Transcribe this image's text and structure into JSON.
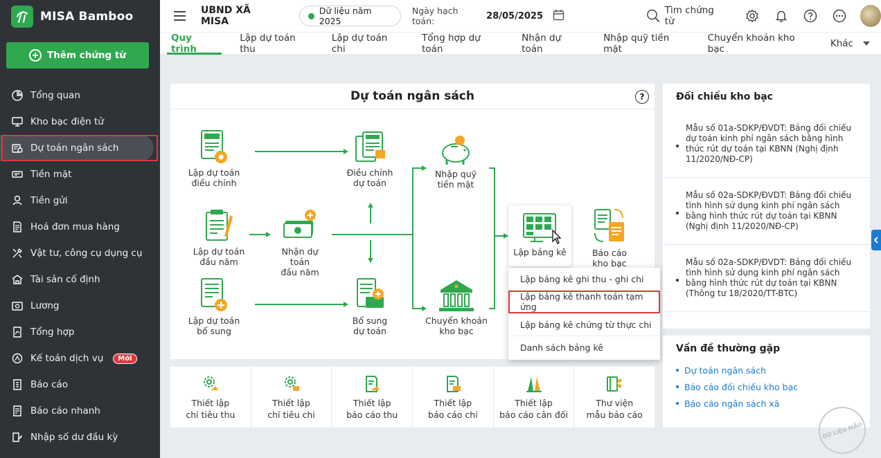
{
  "brand": {
    "name": "MISA Bamboo"
  },
  "sidebar": {
    "add_button": "Thêm chứng từ",
    "items": [
      {
        "label": "Tổng quan",
        "icon": "chart-icon"
      },
      {
        "label": "Kho bạc điện tử",
        "icon": "monitor-icon"
      },
      {
        "label": "Dự toán ngân sách",
        "icon": "budget-icon",
        "active": true
      },
      {
        "label": "Tiền mặt",
        "icon": "cash-icon"
      },
      {
        "label": "Tiền gửi",
        "icon": "deposit-icon"
      },
      {
        "label": "Hoá đơn mua hàng",
        "icon": "invoice-icon"
      },
      {
        "label": "Vật tư, công cụ dụng cụ",
        "icon": "tools-icon"
      },
      {
        "label": "Tài sản cố định",
        "icon": "asset-icon"
      },
      {
        "label": "Lương",
        "icon": "salary-icon"
      },
      {
        "label": "Tổng hợp",
        "icon": "summary-icon"
      },
      {
        "label": "Kế toán dịch vụ",
        "icon": "service-icon",
        "badge": "Mới"
      },
      {
        "label": "Báo cáo",
        "icon": "report-icon"
      },
      {
        "label": "Báo cáo nhanh",
        "icon": "quick-report-icon"
      },
      {
        "label": "Nhập số dư đầu kỳ",
        "icon": "opening-balance-icon"
      }
    ]
  },
  "topbar": {
    "org": "UBND XÃ MISA",
    "year": "Dữ liệu năm 2025",
    "accounting_label": "Ngày hạch toán:",
    "accounting_date": "28/05/2025",
    "search_label": "Tìm chứng từ"
  },
  "tabs": [
    {
      "label": "Quy trình",
      "active": true
    },
    {
      "label": "Lập dự toán thu"
    },
    {
      "label": "Lập dự toán chi"
    },
    {
      "label": "Tổng hợp dự toán"
    },
    {
      "label": "Nhận dự toán"
    },
    {
      "label": "Nhập quỹ tiền mặt"
    },
    {
      "label": "Chuyển khoản kho bạc"
    },
    {
      "label": "Khác"
    }
  ],
  "main": {
    "title": "Dự toán ngân sách",
    "help": "?",
    "nodes": {
      "lap_du_toan_dieu_chinh": "Lập dự toán\nđiều chỉnh",
      "dieu_chinh_du_toan": "Điều chỉnh\ndự toán",
      "nhap_quy_tien_mat": "Nhập quỹ\ntiền mặt",
      "lap_du_toan_dau_nam": "Lập dự toán\nđầu năm",
      "nhan_du_toan_dau_nam": "Nhận dự toán\nđầu năm",
      "lap_bang_ke": "Lập bảng kê",
      "bao_cao_kho_bac": "Báo cáo\nkho bạc",
      "lap_du_toan_bo_sung": "Lập dự toán\nbổ sung",
      "bo_sung_du_toan": "Bổ sung\ndự toán",
      "chuyen_khoan_kho_bac": "Chuyển khoản\nkho bạc"
    }
  },
  "dropdown": {
    "items": [
      "Lập bảng kê ghi thu - ghi chi",
      "Lập bảng kê thanh toán tạm ứng",
      "Lập bảng kê chứng từ thực chi",
      "Danh sách bảng kê"
    ],
    "highlighted": 1
  },
  "settings": [
    "Thiết lập\nchỉ tiêu thu",
    "Thiết lập\nchỉ tiêu chi",
    "Thiết lập\nbáo cáo thu",
    "Thiết lập\nbáo cáo chi",
    "Thiết lập\nbáo cáo cân đối",
    "Thư viện\nmẫu báo cáo"
  ],
  "right_panel": {
    "title": "Đối chiếu kho bạc",
    "items": [
      "Mẫu số 01a-SDKP/ĐVDT: Bảng đối chiếu dự toán kinh phí ngân sách bằng hình thức rút dự toán tại KBNN (Nghị định 11/2020/NĐ-CP)",
      "Mẫu số 02a-SDKP/ĐVDT: Bảng đối chiếu tình hình sử dụng kinh phí ngân sách bằng hình thức rút dự toán tại KBNN (Nghị định 11/2020/NĐ-CP)",
      "Mẫu số 02a-SDKP/ĐVDT: Bảng đối chiếu tình hình sử dụng kinh phí ngân sách bằng hình thức rút dự toán tại KBNN (Thông tư 18/2020/TT-BTC)"
    ]
  },
  "faq": {
    "title": "Vấn đề thường gặp",
    "links": [
      "Dự toán ngân sách",
      "Báo cáo đối chiếu kho bạc",
      "Báo cáo ngân sách xã"
    ]
  },
  "watermark": "DỮ LIỆU MẪU",
  "colors": {
    "brand_green": "#2fa84f",
    "sidebar_bg": "#2f3338",
    "highlight_red": "#e0383e",
    "link_blue": "#1a7bd1",
    "accent_orange": "#f5a623"
  }
}
